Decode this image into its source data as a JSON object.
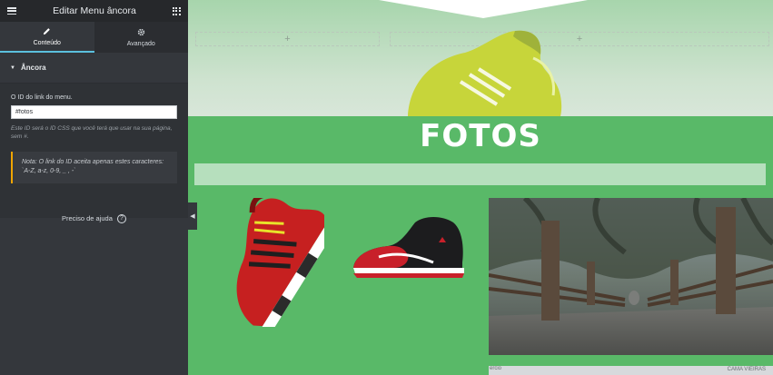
{
  "panel": {
    "title": "Editar Menu âncora",
    "tabs": [
      {
        "label": "Conteúdo",
        "icon": "pencil-icon",
        "active": true
      },
      {
        "label": "Avançado",
        "icon": "gear-icon",
        "active": false
      }
    ],
    "section": {
      "title": "Âncora",
      "field_label": "O ID do link do menu.",
      "input_value": "#fotos",
      "description": "Este ID será o ID CSS que você terá que usar na sua página, sem #.",
      "notice": "Nota: O link do ID aceita apenas estes caracteres: `A-Z, a-z, 0-9, _ , -`"
    },
    "help_label": "Preciso de ajuda",
    "colors": {
      "tab_accent": "#5bc0de",
      "notice_border": "#f0a500"
    }
  },
  "canvas": {
    "section_title": "FOTOS",
    "add_icon": "+",
    "map_label_left": "ercio",
    "map_label_right": "CAMA VIEIRAS",
    "colors": {
      "section_bg": "#59b968",
      "title_text": "#ffffff"
    }
  }
}
